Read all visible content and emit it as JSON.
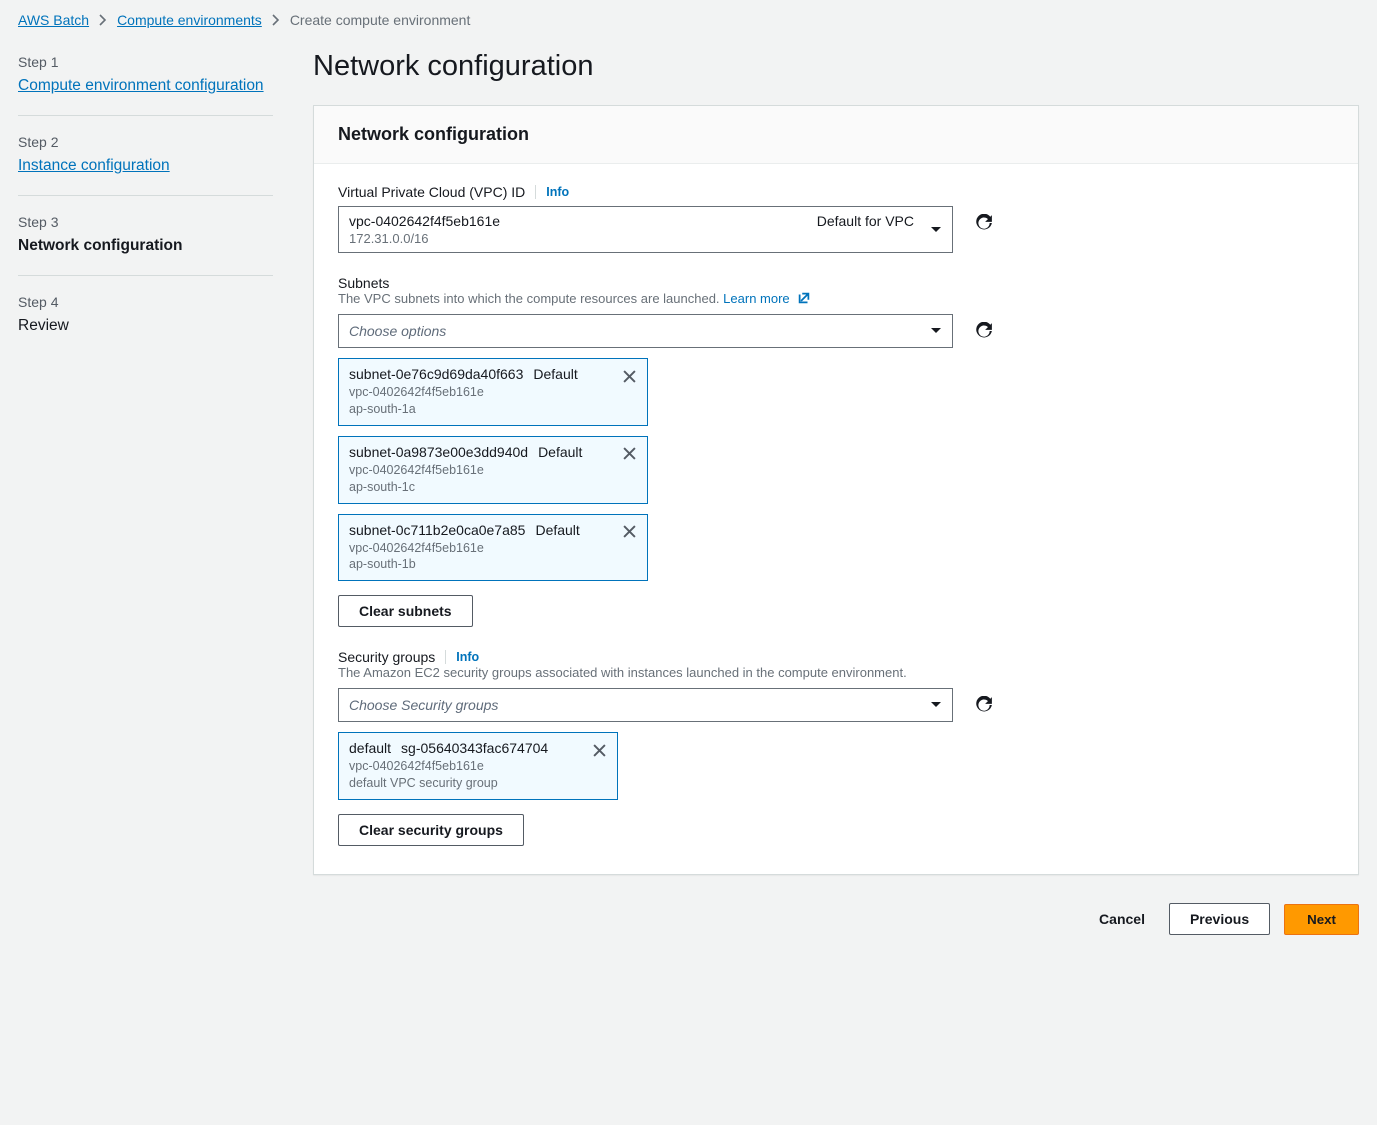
{
  "breadcrumb": {
    "items": [
      "AWS Batch",
      "Compute environments"
    ],
    "current": "Create compute environment"
  },
  "sidebar": {
    "steps": [
      {
        "label": "Step 1",
        "title": "Compute environment configuration",
        "link": true
      },
      {
        "label": "Step 2",
        "title": "Instance configuration",
        "link": true
      },
      {
        "label": "Step 3",
        "title": "Network configuration",
        "current": true
      },
      {
        "label": "Step 4",
        "title": "Review"
      }
    ]
  },
  "page_title": "Network configuration",
  "panel": {
    "title": "Network configuration",
    "vpc": {
      "label": "Virtual Private Cloud (VPC) ID",
      "info": "Info",
      "value": "vpc-0402642f4f5eb161e",
      "right": "Default for VPC",
      "cidr": "172.31.0.0/16"
    },
    "subnets": {
      "label": "Subnets",
      "desc": "The VPC subnets into which the compute resources are launched.",
      "learn_more": "Learn more",
      "placeholder": "Choose options",
      "items": [
        {
          "id": "subnet-0e76c9d69da40f663",
          "tag": "Default",
          "vpc": "vpc-0402642f4f5eb161e",
          "az": "ap-south-1a"
        },
        {
          "id": "subnet-0a9873e00e3dd940d",
          "tag": "Default",
          "vpc": "vpc-0402642f4f5eb161e",
          "az": "ap-south-1c"
        },
        {
          "id": "subnet-0c711b2e0ca0e7a85",
          "tag": "Default",
          "vpc": "vpc-0402642f4f5eb161e",
          "az": "ap-south-1b"
        }
      ],
      "clear": "Clear subnets"
    },
    "security_groups": {
      "label": "Security groups",
      "info": "Info",
      "desc": "The Amazon EC2 security groups associated with instances launched in the compute environment.",
      "placeholder": "Choose Security groups",
      "items": [
        {
          "name": "default",
          "id": "sg-05640343fac674704",
          "vpc": "vpc-0402642f4f5eb161e",
          "desc": "default VPC security group"
        }
      ],
      "clear": "Clear security groups"
    }
  },
  "footer": {
    "cancel": "Cancel",
    "previous": "Previous",
    "next": "Next"
  }
}
